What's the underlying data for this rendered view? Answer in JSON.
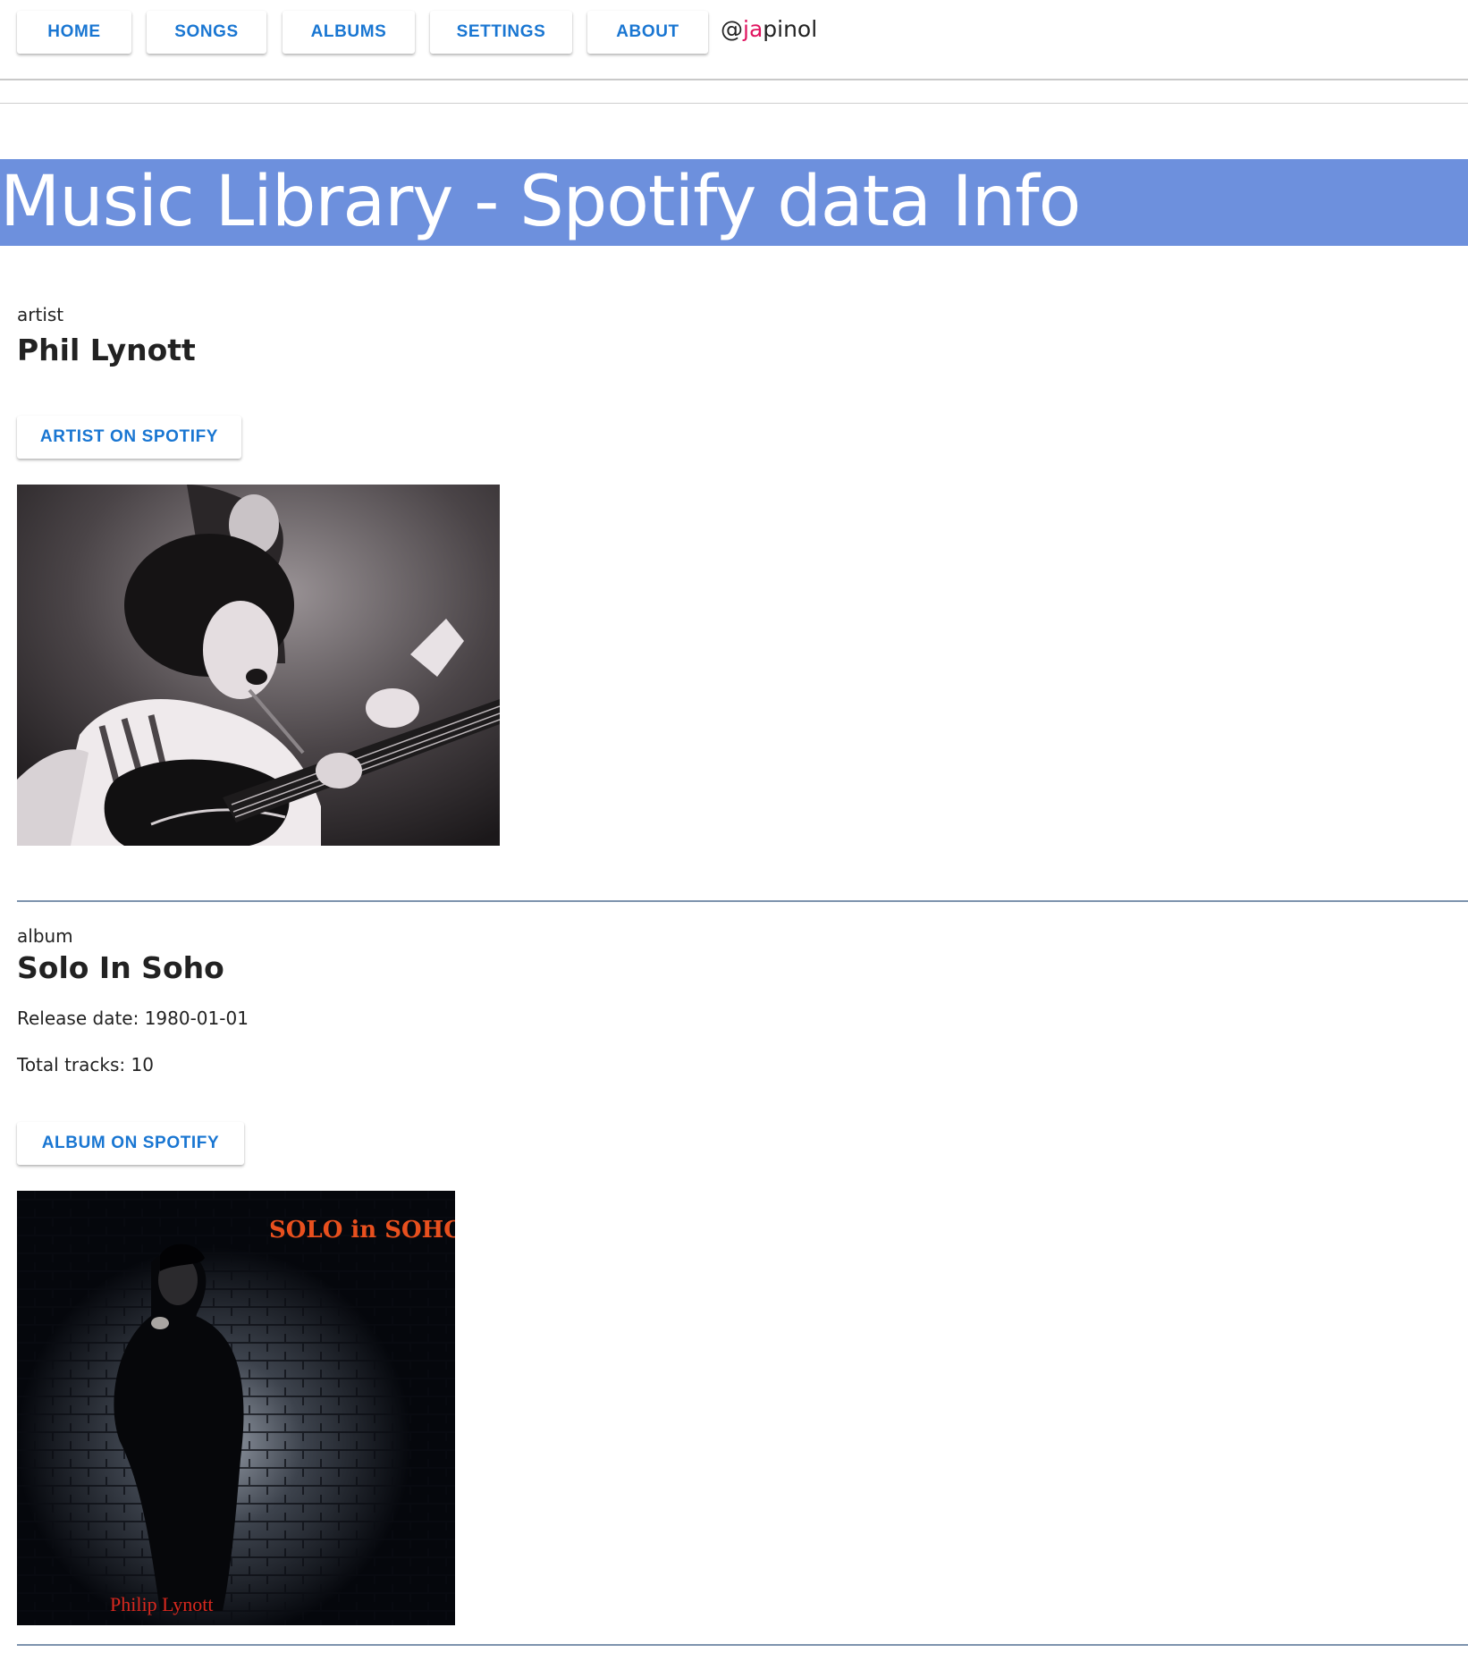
{
  "nav": {
    "items": [
      {
        "label": "HOME"
      },
      {
        "label": "SONGS"
      },
      {
        "label": "ALBUMS"
      },
      {
        "label": "SETTINGS"
      },
      {
        "label": "ABOUT"
      }
    ],
    "handle": {
      "prefix": "@",
      "accent": "ja",
      "rest": "pinol"
    }
  },
  "banner": {
    "title": "Music Library - Spotify data Info"
  },
  "artist": {
    "section_label": "artist",
    "name": "Phil Lynott",
    "spotify_button": "ARTIST ON SPOTIFY",
    "image_icon": "artist-photo"
  },
  "album": {
    "section_label": "album",
    "name": "Solo In Soho",
    "release_date": "Release date: 1980-01-01",
    "total_tracks": "Total tracks: 10",
    "spotify_button": "ALBUM ON SPOTIFY",
    "cover_title": "SOLO in SOHO",
    "cover_artist": "Philip Lynott"
  },
  "colors": {
    "banner": "#6d90dd",
    "button_text": "#1976d2",
    "handle_accent": "#e0145f",
    "section_rule": "#7d93ad",
    "cover_title": "#e8501e",
    "cover_artist": "#d8281e"
  }
}
